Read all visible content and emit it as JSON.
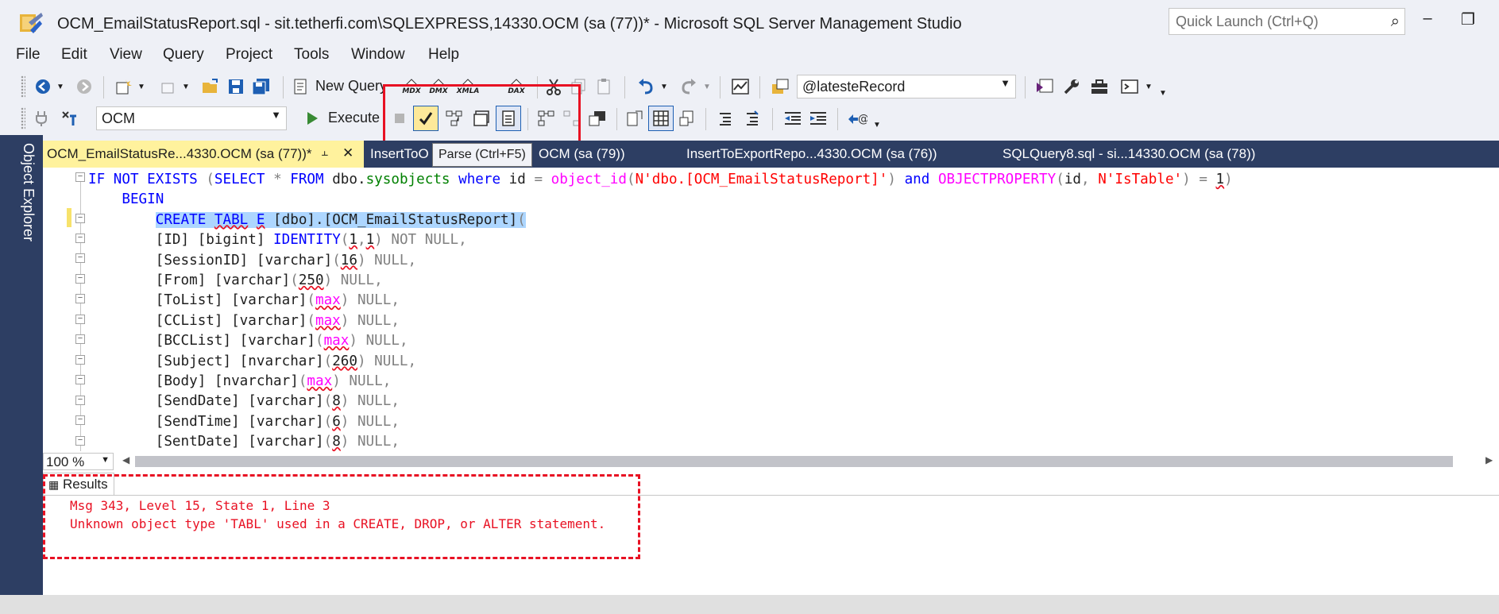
{
  "window": {
    "title": "OCM_EmailStatusReport.sql - sit.tetherfi.com\\SQLEXPRESS,14330.OCM (sa (77))* - Microsoft SQL Server Management Studio",
    "quick_launch_placeholder": "Quick Launch (Ctrl+Q)",
    "minimize": "–",
    "restore": "❐"
  },
  "menu": [
    "File",
    "Edit",
    "View",
    "Query",
    "Project",
    "Tools",
    "Window",
    "Help"
  ],
  "toolbar1": {
    "new_query_label": "New Query",
    "mini_labels": [
      "MDX",
      "DMX",
      "XMLA",
      "DAX"
    ],
    "parameter_combo": "@latesteRecord"
  },
  "toolbar2": {
    "database_combo": "OCM",
    "execute_label": "Execute"
  },
  "tooltip": "Parse (Ctrl+F5)",
  "sidebar": {
    "object_explorer_label": "Object Explorer"
  },
  "tabs": [
    {
      "label": "OCM_EmailStatusRe...4330.OCM (sa (77))*",
      "pin": "⫠",
      "close": "✕"
    },
    {
      "label": "InsertToO"
    },
    {
      "label": "OCM (sa (79))"
    },
    {
      "label": "InsertToExportRepo...4330.OCM (sa (76))"
    },
    {
      "label": "SQLQuery8.sql - si...14330.OCM (sa (78))"
    }
  ],
  "editor": {
    "lines": [
      "IF NOT EXISTS (SELECT * FROM dbo.sysobjects where id = object_id(N'dbo.[OCM_EmailStatusReport]') and OBJECTPROPERTY(id, N'IsTable') = 1)",
      "    BEGIN",
      "        CREATE TABL E [dbo].[OCM_EmailStatusReport](",
      "        [ID] [bigint] IDENTITY(1,1) NOT NULL,",
      "        [SessionID] [varchar](16) NULL,",
      "        [From] [varchar](250) NULL,",
      "        [ToList] [varchar](max) NULL,",
      "        [CCList] [varchar](max) NULL,",
      "        [BCCList] [varchar](max) NULL,",
      "        [Subject] [nvarchar](260) NULL,",
      "        [Body] [nvarchar](max) NULL,",
      "        [SendDate] [varchar](8) NULL,",
      "        [SendTime] [varchar](6) NULL,",
      "        [SentDate] [varchar](8) NULL,"
    ],
    "zoom": "100 %"
  },
  "results": {
    "tab_label": "Results",
    "messages": [
      "Msg 343, Level 15, State 1, Line 3",
      "Unknown object type 'TABL' used in a CREATE, DROP, or ALTER statement."
    ]
  },
  "colors": {
    "keyword": "#0000ff",
    "function": "#ff00ff",
    "string": "#ff0000",
    "comment_gray": "#808080",
    "highlight_box": "#e81123",
    "active_tab": "#fff29d",
    "tab_strip": "#2d3e63"
  },
  "icons": [
    "app-icon",
    "search-icon",
    "back-icon",
    "forward-icon",
    "new-project-icon",
    "open-icon",
    "save-icon",
    "save-all-icon",
    "new-query-icon",
    "cut-icon",
    "copy-icon",
    "paste-icon",
    "undo-icon",
    "redo-icon",
    "activity-monitor-icon",
    "parameter-icon",
    "solution-explorer-icon",
    "wrench-icon",
    "toolbox-icon",
    "terminal-icon",
    "connect-icon",
    "filter-icon",
    "execute-icon",
    "stop-icon",
    "parse-icon",
    "display-plan-icon",
    "query-options-icon",
    "intellisense-icon",
    "comment-icon",
    "uncomment-icon",
    "indent-icon",
    "outdent-icon",
    "specify-values-icon"
  ]
}
